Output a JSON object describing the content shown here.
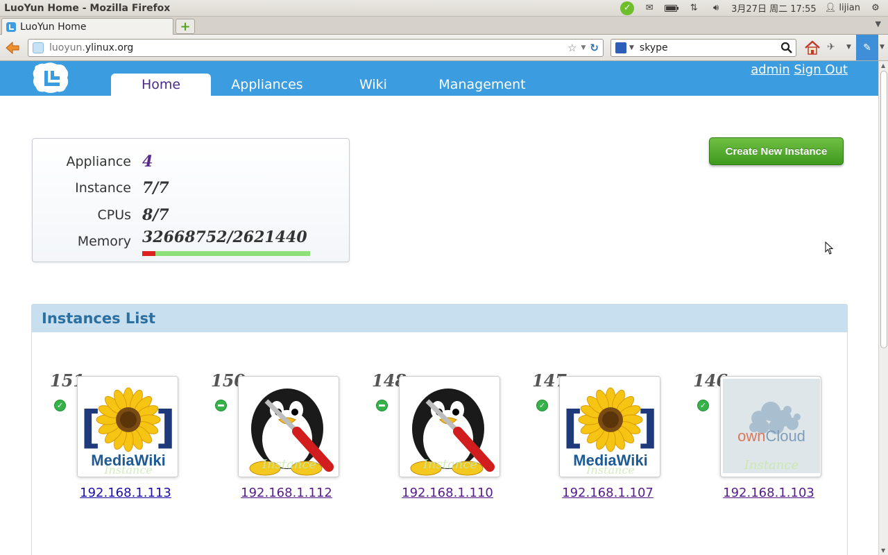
{
  "os_panel": {
    "window_title": "LuoYun Home - Mozilla Firefox",
    "datetime": "3月27日 周二 17:55",
    "user": "lijian"
  },
  "browser": {
    "tab_title": "LuoYun Home",
    "url_prefix": "luoyun.",
    "url_host": "ylinux.org",
    "search_value": "skype"
  },
  "site": {
    "nav": [
      "Home",
      "Appliances",
      "Wiki",
      "Management"
    ],
    "active_nav": "Home",
    "auth": {
      "user": "admin",
      "signout": "Sign Out"
    },
    "accent_color": "#3b9ddf"
  },
  "summary": {
    "appliance_label": "Appliance",
    "appliance_value": "4",
    "instance_label": "Instance",
    "instance_value": "7/7",
    "cpus_label": "CPUs",
    "cpus_value": "8/7",
    "memory_label": "Memory",
    "memory_value": "32668752/2621440",
    "memory_bar_fraction": 0.08
  },
  "create_button": "Create New Instance",
  "instances": {
    "title": "Instances List",
    "items": [
      {
        "id": "151",
        "ip": "192.168.1.113",
        "status": "ok",
        "image": "mediawiki-icon"
      },
      {
        "id": "150",
        "ip": "192.168.1.112",
        "status": "running",
        "image": "tux-tools-icon"
      },
      {
        "id": "148",
        "ip": "192.168.1.110",
        "status": "running",
        "image": "tux-tools-icon"
      },
      {
        "id": "147",
        "ip": "192.168.1.107",
        "status": "ok",
        "image": "mediawiki-icon"
      },
      {
        "id": "146",
        "ip": "192.168.1.103",
        "status": "ok",
        "image": "owncloud-icon"
      }
    ],
    "watermark": "Instance",
    "mediawiki_text": "MediaWiki",
    "owncloud_text": "ownCloud"
  }
}
